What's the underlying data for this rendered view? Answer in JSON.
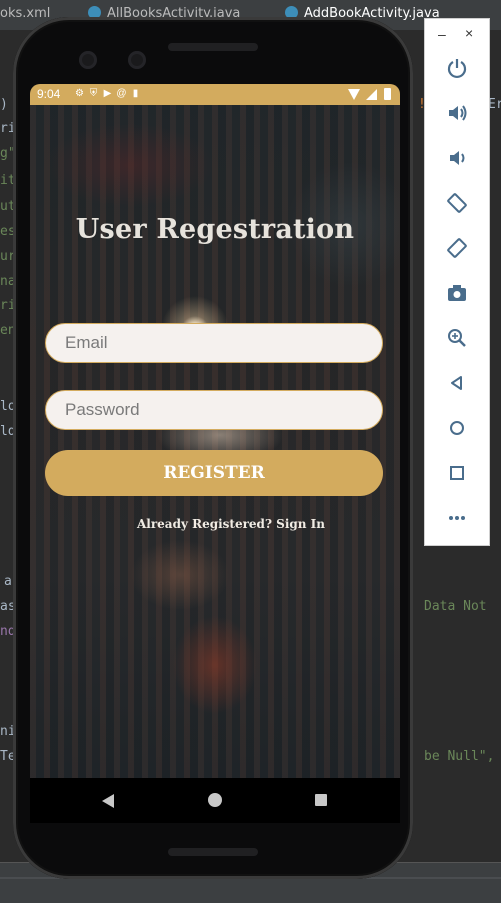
{
  "ide": {
    "tabs": [
      {
        "label": "oks.xml",
        "active": false
      },
      {
        "label": "AllBooksActivity.java",
        "active": false
      },
      {
        "label": "AddBookActivity.java",
        "active": true
      }
    ],
    "code_left": [
      ")",
      "ri",
      "g\"",
      "it",
      "ut",
      "es",
      "ur",
      "na",
      "ri",
      "en",
      "lo",
      "ld",
      "a",
      "as",
      "nd",
      "ni",
      "Te"
    ],
    "code_right": [
      "!",
      "Er",
      "Data Not",
      "be Null\","
    ]
  },
  "phone": {
    "status": {
      "time": "9:04",
      "notification_icons": [
        "settings-icon",
        "shield-icon",
        "play-icon",
        "at-icon",
        "sd-card-icon"
      ],
      "accent": "#d3ab5e"
    },
    "screen": {
      "title": "User Regestration",
      "email_placeholder": "Email",
      "password_placeholder": "Password",
      "register_label": "REGISTER",
      "signin_text": "Already Registered? Sign In"
    }
  },
  "emulator_toolbar": {
    "minimize": "–",
    "close": "×",
    "buttons": [
      "power-icon",
      "volume-up-icon",
      "volume-down-icon",
      "rotate-left-icon",
      "rotate-right-icon",
      "camera-icon",
      "zoom-icon",
      "back-icon",
      "home-icon",
      "overview-icon",
      "more-icon"
    ]
  }
}
